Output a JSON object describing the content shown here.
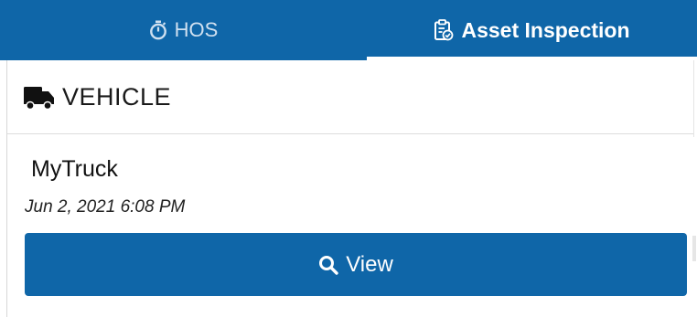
{
  "tabs": [
    {
      "label": "HOS",
      "icon": "stopwatch-icon",
      "active": false
    },
    {
      "label": "Asset Inspection",
      "icon": "clipboard-check-icon",
      "active": true
    }
  ],
  "section": {
    "title": "VEHICLE",
    "icon": "truck-icon"
  },
  "asset": {
    "name": "MyTruck",
    "date": "Jun 2, 2021 6:08 PM"
  },
  "actions": {
    "view_label": "View",
    "view_icon": "search-icon"
  },
  "colors": {
    "primary": "#0f66a8",
    "inactive_tab_text": "#cfe0f0",
    "background": "#ffffff"
  }
}
